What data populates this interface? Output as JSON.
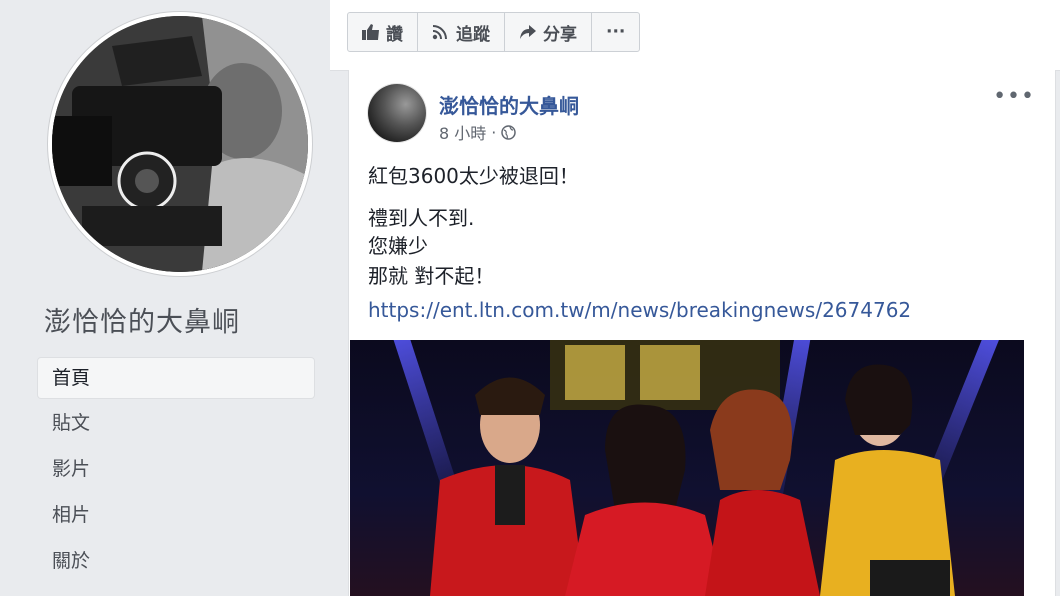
{
  "sidebar": {
    "page_name": "澎恰恰的大鼻峒",
    "nav": [
      "首頁",
      "貼文",
      "影片",
      "相片",
      "關於"
    ]
  },
  "actionbar": {
    "like": "讚",
    "follow": "追蹤",
    "share": "分享",
    "more": "···"
  },
  "post": {
    "author": "澎恰恰的大鼻峒",
    "time": "8 小時",
    "menu": "•••",
    "lines": [
      "紅包3600太少被退回！",
      "禮到人不到.",
      "您嫌少",
      "那就 對不起！"
    ],
    "link": "https://ent.ltn.com.tw/m/news/breakingnews/2674762"
  },
  "colors": {
    "link": "#365899",
    "background": "#e9ebee"
  }
}
